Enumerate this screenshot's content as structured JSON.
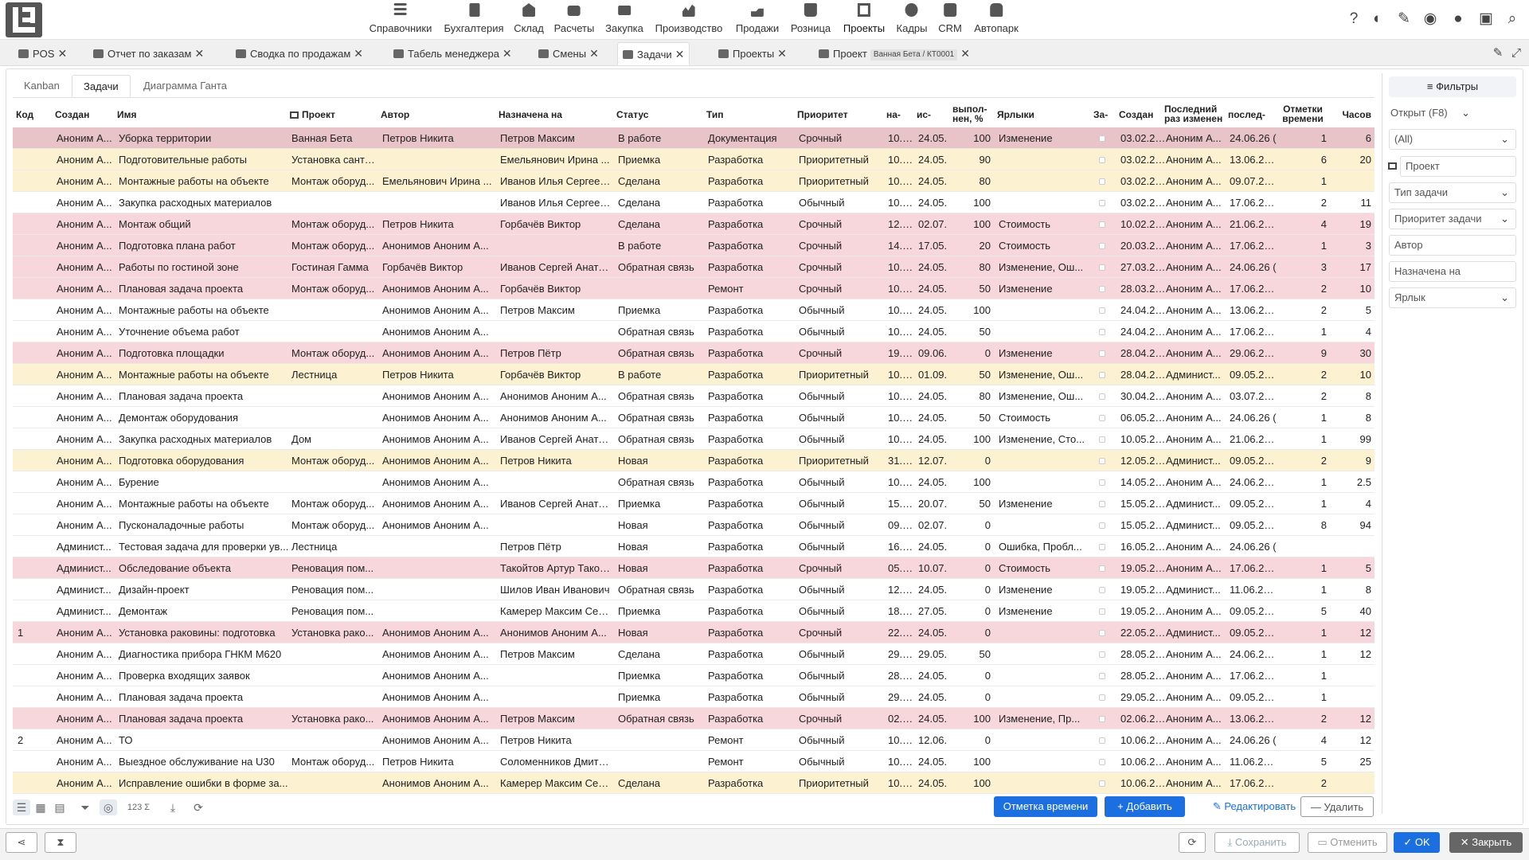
{
  "top_menu": [
    {
      "label": "Справочники",
      "icon": "list-icon"
    },
    {
      "label": "Бухгалтерия",
      "icon": "document-icon"
    },
    {
      "label": "Склад",
      "icon": "warehouse-icon"
    },
    {
      "label": "Расчеты",
      "icon": "money-icon"
    },
    {
      "label": "Закупка",
      "icon": "cart-icon"
    },
    {
      "label": "Производство",
      "icon": "factory-chart-icon"
    },
    {
      "label": "Продажи",
      "icon": "hand-coin-icon"
    },
    {
      "label": "Розница",
      "icon": "shopping-bag-icon"
    },
    {
      "label": "Проекты",
      "icon": "project-flow-icon"
    },
    {
      "label": "Кадры",
      "icon": "fingerprint-icon"
    },
    {
      "label": "CRM",
      "icon": "person-card-icon"
    },
    {
      "label": "Автопарк",
      "icon": "bus-icon"
    }
  ],
  "top_right_icons": [
    "help-icon",
    "theme-contrast-icon",
    "pin-icon",
    "eye-icon",
    "chat-icon",
    "lock-icon",
    "search-icon"
  ],
  "tabs": [
    {
      "label": "POS",
      "icon": "pos-icon"
    },
    {
      "label": "Отчет по заказам",
      "icon": "sort-report-icon"
    },
    {
      "label": "Сводка по продажам",
      "icon": "sales-summary-icon"
    },
    {
      "label": "Табель менеджера",
      "icon": "timesheet-icon"
    },
    {
      "label": "Смены",
      "icon": "shifts-icon"
    },
    {
      "label": "Задачи",
      "icon": "tasks-icon"
    },
    {
      "label": "Проекты",
      "icon": "projects-icon"
    },
    {
      "label": "Проект",
      "icon": "project-icon",
      "badge": "Ванная Бета / КТ0001"
    }
  ],
  "subtabs": [
    "Kanban",
    "Задачи",
    "Диаграмма Ганта"
  ],
  "columns": {
    "code": "Код",
    "created_by": "Создан",
    "name": "Имя",
    "project": "Проект",
    "author": "Автор",
    "assignee": "Назначена на",
    "status": "Статус",
    "type": "Тип",
    "priority": "Приоритет",
    "start": "на-",
    "end": "ис-",
    "done": "выпол-нен, %",
    "tags": "Ярлыки",
    "flag": "За-",
    "created": "Создан",
    "last_change": "Последний раз изменен",
    "last_date": "послед-",
    "time_marks": "Отметки времени",
    "hours": "Часов"
  },
  "rows": [
    {
      "hl": "first",
      "code": "",
      "cb": "Аноним А...",
      "name": "Уборка территории",
      "project": "Ванная Бета",
      "author": "Петров Никита",
      "assignee": "Петров Максим",
      "status": "В работе",
      "type": "Документация",
      "priority": "Срочный",
      "start": "10.05.",
      "end": "24.05.",
      "done": "100",
      "tags": "Изменение",
      "created": "03.02.25 2",
      "lc": "Аноним А...",
      "ld": "24.06.26 (",
      "tm": "1",
      "hours": "6"
    },
    {
      "hl": "yellow",
      "code": "",
      "cb": "Аноним А...",
      "name": "Подготовительные работы",
      "project": "Установка санте...",
      "author": "",
      "assignee": "Емельянович Ирина ...",
      "status": "Приемка",
      "type": "Разработка",
      "priority": "Приоритетный",
      "start": "10.05.",
      "end": "24.05.",
      "done": "90",
      "tags": "",
      "created": "03.02.25 2",
      "lc": "Аноним А...",
      "ld": "13.06.26 1",
      "tm": "6",
      "hours": "20"
    },
    {
      "hl": "yellow",
      "code": "",
      "cb": "Аноним А...",
      "name": "Монтажные работы на объекте",
      "project": "Монтаж оборуд...",
      "author": "Емельянович Ирина ...",
      "assignee": "Иванов Илья Сергеев...",
      "status": "Сделана",
      "type": "Разработка",
      "priority": "Приоритетный",
      "start": "10.05.",
      "end": "24.05.",
      "done": "80",
      "tags": "",
      "created": "03.02.25 2",
      "lc": "Аноним А...",
      "ld": "09.07.26 1",
      "tm": "1",
      "hours": ""
    },
    {
      "hl": "",
      "code": "",
      "cb": "Аноним А...",
      "name": "Закупка расходных материалов",
      "project": "",
      "author": "",
      "assignee": "Иванов Илья Сергеев...",
      "status": "Сделана",
      "type": "Разработка",
      "priority": "Обычный",
      "start": "10.05.",
      "end": "24.05.",
      "done": "100",
      "tags": "",
      "created": "03.02.25 2",
      "lc": "Аноним А...",
      "ld": "17.06.26 1",
      "tm": "2",
      "hours": "11"
    },
    {
      "hl": "red",
      "code": "",
      "cb": "Аноним А...",
      "name": "Монтаж общий",
      "project": "Монтаж оборуд...",
      "author": "Петров Никита",
      "assignee": "Горбачёв Виктор",
      "status": "Сделана",
      "type": "Разработка",
      "priority": "Срочный",
      "start": "12.05.",
      "end": "02.07.",
      "done": "100",
      "tags": "Стоимость",
      "created": "10.02.25 2",
      "lc": "Аноним А...",
      "ld": "21.06.26 1",
      "tm": "4",
      "hours": "19"
    },
    {
      "hl": "red",
      "code": "",
      "cb": "Аноним А...",
      "name": "Подготовка плана работ",
      "project": "Монтаж оборуд...",
      "author": "Анонимов Аноним А...",
      "assignee": "",
      "status": "В работе",
      "type": "Разработка",
      "priority": "Срочный",
      "start": "14.05.",
      "end": "17.05.",
      "done": "20",
      "tags": "Стоимость",
      "created": "20.03.25 0",
      "lc": "Аноним А...",
      "ld": "17.06.26 1",
      "tm": "1",
      "hours": "3"
    },
    {
      "hl": "red",
      "code": "",
      "cb": "Аноним А...",
      "name": "Работы по гостиной зоне",
      "project": "Гостиная Гамма",
      "author": "Горбачёв Виктор",
      "assignee": "Иванов Сергей Анато...",
      "status": "Обратная связь",
      "type": "Разработка",
      "priority": "Срочный",
      "start": "10.05.",
      "end": "24.05.",
      "done": "80",
      "tags": "Изменение, Ош...",
      "created": "27.03.25 0",
      "lc": "Аноним А...",
      "ld": "24.06.26 (",
      "tm": "3",
      "hours": "17"
    },
    {
      "hl": "red",
      "code": "",
      "cb": "Аноним А...",
      "name": "Плановая задача проекта",
      "project": "Монтаж оборуд...",
      "author": "Анонимов Аноним А...",
      "assignee": "Горбачёв Виктор",
      "status": "",
      "type": "Ремонт",
      "priority": "Срочный",
      "start": "10.05.",
      "end": "24.05.",
      "done": "50",
      "tags": "Изменение",
      "created": "28.03.25 0",
      "lc": "Аноним А...",
      "ld": "17.06.26 1",
      "tm": "2",
      "hours": "10"
    },
    {
      "hl": "",
      "code": "",
      "cb": "Аноним А...",
      "name": "Монтажные работы на объекте",
      "project": "",
      "author": "Анонимов Аноним А...",
      "assignee": "Петров Максим",
      "status": "Приемка",
      "type": "Разработка",
      "priority": "Обычный",
      "start": "10.05.",
      "end": "24.05.",
      "done": "100",
      "tags": "",
      "created": "24.04.25 1",
      "lc": "Аноним А...",
      "ld": "13.06.26 1",
      "tm": "2",
      "hours": "5"
    },
    {
      "hl": "",
      "code": "",
      "cb": "Аноним А...",
      "name": "Уточнение объема работ",
      "project": "",
      "author": "Анонимов Аноним А...",
      "assignee": "",
      "status": "Обратная связь",
      "type": "Разработка",
      "priority": "Обычный",
      "start": "10.05.",
      "end": "24.05.",
      "done": "50",
      "tags": "",
      "created": "24.04.25 1",
      "lc": "Аноним А...",
      "ld": "17.06.26 1",
      "tm": "1",
      "hours": "4"
    },
    {
      "hl": "red",
      "code": "",
      "cb": "Аноним А...",
      "name": "Подготовка площадки",
      "project": "Монтаж оборуд...",
      "author": "Анонимов Аноним А...",
      "assignee": "Петров Пётр",
      "status": "Обратная связь",
      "type": "Разработка",
      "priority": "Срочный",
      "start": "19.05.",
      "end": "09.06.",
      "done": "0",
      "tags": "Изменение",
      "created": "28.04.25 0",
      "lc": "Аноним А...",
      "ld": "29.06.26 2",
      "tm": "9",
      "hours": "30"
    },
    {
      "hl": "yellow",
      "code": "",
      "cb": "Аноним А...",
      "name": "Монтажные работы на объекте",
      "project": "Лестница",
      "author": "Петров Никита",
      "assignee": "Горбачёв Виктор",
      "status": "В работе",
      "type": "Разработка",
      "priority": "Приоритетный",
      "start": "10.05.",
      "end": "01.09.",
      "done": "50",
      "tags": "Изменение, Ош...",
      "created": "28.04.25 1",
      "lc": "Админист...",
      "ld": "09.05.26 1",
      "tm": "2",
      "hours": "10"
    },
    {
      "hl": "",
      "code": "",
      "cb": "Аноним А...",
      "name": "Плановая задача проекта",
      "project": "",
      "author": "Анонимов Аноним А...",
      "assignee": "Анонимов Аноним А...",
      "status": "Обратная связь",
      "type": "Разработка",
      "priority": "Обычный",
      "start": "10.05.",
      "end": "24.05.",
      "done": "80",
      "tags": "Изменение, Ош...",
      "created": "30.04.25 2",
      "lc": "Аноним А...",
      "ld": "03.07.26 1",
      "tm": "2",
      "hours": "8"
    },
    {
      "hl": "",
      "code": "",
      "cb": "Аноним А...",
      "name": "Демонтаж оборудования",
      "project": "",
      "author": "Анонимов Аноним А...",
      "assignee": "Анонимов Аноним А...",
      "status": "Обратная связь",
      "type": "Разработка",
      "priority": "Обычный",
      "start": "10.05.",
      "end": "24.05.",
      "done": "50",
      "tags": "Стоимость",
      "created": "06.05.25 2",
      "lc": "Аноним А...",
      "ld": "24.06.26 (",
      "tm": "1",
      "hours": "8"
    },
    {
      "hl": "",
      "code": "",
      "cb": "Аноним А...",
      "name": "Закупка расходных материалов",
      "project": "Дом",
      "author": "Анонимов Аноним А...",
      "assignee": "Иванов Сергей Анато...",
      "status": "Обратная связь",
      "type": "Разработка",
      "priority": "Обычный",
      "start": "10.05.",
      "end": "24.05.",
      "done": "100",
      "tags": "Изменение, Сто...",
      "created": "10.05.25 2",
      "lc": "Аноним А...",
      "ld": "21.06.26 1",
      "tm": "1",
      "hours": "99"
    },
    {
      "hl": "yellow",
      "code": "",
      "cb": "Аноним А...",
      "name": "Подготовка оборудования",
      "project": "Монтаж оборуд...",
      "author": "Анонимов Аноним А...",
      "assignee": "Петров Никита",
      "status": "Новая",
      "type": "Разработка",
      "priority": "Приоритетный",
      "start": "31.05.",
      "end": "12.07.",
      "done": "0",
      "tags": "",
      "created": "12.05.25 0",
      "lc": "Админист...",
      "ld": "09.05.26 1",
      "tm": "2",
      "hours": "9"
    },
    {
      "hl": "",
      "code": "",
      "cb": "Аноним А...",
      "name": "Бурение",
      "project": "",
      "author": "Анонимов Аноним А...",
      "assignee": "",
      "status": "Обратная связь",
      "type": "Разработка",
      "priority": "Обычный",
      "start": "10.05.",
      "end": "24.05.",
      "done": "100",
      "tags": "",
      "created": "14.05.25 0",
      "lc": "Аноним А...",
      "ld": "24.06.26 2",
      "tm": "1",
      "hours": "2.5"
    },
    {
      "hl": "",
      "code": "",
      "cb": "Аноним А...",
      "name": "Монтажные работы на объекте",
      "project": "Монтаж оборуд...",
      "author": "Анонимов Аноним А...",
      "assignee": "Иванов Сергей Анато...",
      "status": "Приемка",
      "type": "Разработка",
      "priority": "Обычный",
      "start": "15.06.",
      "end": "20.07.",
      "done": "50",
      "tags": "Изменение",
      "created": "15.05.25 1",
      "lc": "Админист...",
      "ld": "09.05.26 1",
      "tm": "1",
      "hours": "4"
    },
    {
      "hl": "",
      "code": "",
      "cb": "Аноним А...",
      "name": "Пусконаладочные работы",
      "project": "Монтаж оборуд...",
      "author": "Анонимов Аноним А...",
      "assignee": "",
      "status": "Новая",
      "type": "Разработка",
      "priority": "Обычный",
      "start": "09.06.",
      "end": "02.07.",
      "done": "0",
      "tags": "",
      "created": "15.05.25 1",
      "lc": "Админист...",
      "ld": "09.05.26 1",
      "tm": "8",
      "hours": "94"
    },
    {
      "hl": "",
      "code": "",
      "cb": "Админист...",
      "name": "Тестовая задача для проверки ув...",
      "project": "Лестница",
      "author": "",
      "assignee": "Петров Пётр",
      "status": "Новая",
      "type": "Разработка",
      "priority": "Обычный",
      "start": "16.05.",
      "end": "24.05.",
      "done": "0",
      "tags": "Ошибка, Пробл...",
      "created": "16.05.25 1",
      "lc": "Аноним А...",
      "ld": "24.06.26 (",
      "tm": "",
      "hours": ""
    },
    {
      "hl": "red",
      "code": "",
      "cb": "Админист...",
      "name": "Обследование объекта",
      "project": "Реновация пом...",
      "author": "",
      "assignee": "Такойтов Артур Такой...",
      "status": "Новая",
      "type": "Разработка",
      "priority": "Срочный",
      "start": "05.07.",
      "end": "10.07.",
      "done": "0",
      "tags": "Стоимость",
      "created": "19.05.25 0",
      "lc": "Аноним А...",
      "ld": "17.06.26 1",
      "tm": "1",
      "hours": "5"
    },
    {
      "hl": "",
      "code": "",
      "cb": "Админист...",
      "name": "Дизайн-проект",
      "project": "Реновация пом...",
      "author": "",
      "assignee": "Шилов Иван Иванович",
      "status": "Обратная связь",
      "type": "Разработка",
      "priority": "Обычный",
      "start": "12.05.",
      "end": "24.05.",
      "done": "0",
      "tags": "Изменение",
      "created": "19.05.25 0",
      "lc": "Админист...",
      "ld": "11.06.26 1",
      "tm": "1",
      "hours": "8"
    },
    {
      "hl": "",
      "code": "",
      "cb": "Админист...",
      "name": "Демонтаж",
      "project": "Реновация пом...",
      "author": "",
      "assignee": "Камерер Максим Сер...",
      "status": "Приемка",
      "type": "Разработка",
      "priority": "Обычный",
      "start": "18.05.",
      "end": "27.05.",
      "done": "0",
      "tags": "Изменение",
      "created": "19.05.25 0",
      "lc": "Аноним А...",
      "ld": "09.05.26 1",
      "tm": "5",
      "hours": "40"
    },
    {
      "hl": "red",
      "code": "1",
      "cb": "Аноним А...",
      "name": "Установка раковины: подготовка",
      "project": "Установка рако...",
      "author": "Анонимов Аноним А...",
      "assignee": "Анонимов Аноним А...",
      "status": "Новая",
      "type": "Разработка",
      "priority": "Срочный",
      "start": "22.05.",
      "end": "24.05.",
      "done": "0",
      "tags": "",
      "created": "22.05.25 0",
      "lc": "Админист...",
      "ld": "09.05.26 1",
      "tm": "1",
      "hours": "12"
    },
    {
      "hl": "",
      "code": "",
      "cb": "Аноним А...",
      "name": "Диагностика прибора ГНКМ М620",
      "project": "",
      "author": "Анонимов Аноним А...",
      "assignee": "Петров Максим",
      "status": "Сделана",
      "type": "Разработка",
      "priority": "Обычный",
      "start": "29.05.",
      "end": "29.05.",
      "done": "50",
      "tags": "",
      "created": "28.05.25 0",
      "lc": "Аноним А...",
      "ld": "24.06.26 2",
      "tm": "1",
      "hours": "12"
    },
    {
      "hl": "",
      "code": "",
      "cb": "Аноним А...",
      "name": "Проверка входящих заявок",
      "project": "",
      "author": "Анонимов Аноним А...",
      "assignee": "",
      "status": "Приемка",
      "type": "Разработка",
      "priority": "Обычный",
      "start": "28.05.",
      "end": "24.05.",
      "done": "0",
      "tags": "",
      "created": "28.05.25 0",
      "lc": "Аноним А...",
      "ld": "17.06.26 1",
      "tm": "1",
      "hours": ""
    },
    {
      "hl": "",
      "code": "",
      "cb": "Аноним А...",
      "name": "Плановая задача проекта",
      "project": "",
      "author": "Анонимов Аноним А...",
      "assignee": "",
      "status": "Приемка",
      "type": "Разработка",
      "priority": "Обычный",
      "start": "29.05.",
      "end": "24.05.",
      "done": "0",
      "tags": "",
      "created": "29.05.25 0",
      "lc": "Аноним А...",
      "ld": "09.05.26 1",
      "tm": "1",
      "hours": ""
    },
    {
      "hl": "red",
      "code": "",
      "cb": "Аноним А...",
      "name": "Плановая задача проекта",
      "project": "Установка рако...",
      "author": "Анонимов Аноним А...",
      "assignee": "Петров Максим",
      "status": "Обратная связь",
      "type": "Разработка",
      "priority": "Срочный",
      "start": "02.06.",
      "end": "24.05.",
      "done": "100",
      "tags": "Изменение, Пр...",
      "created": "02.06.25 2",
      "lc": "Аноним А...",
      "ld": "13.06.26 1",
      "tm": "2",
      "hours": "12"
    },
    {
      "hl": "",
      "code": "2",
      "cb": "Аноним А...",
      "name": "ТО",
      "project": "",
      "author": "Анонимов Аноним А...",
      "assignee": "Петров Никита",
      "status": "",
      "type": "Ремонт",
      "priority": "Обычный",
      "start": "10.06.",
      "end": "12.06.",
      "done": "0",
      "tags": "",
      "created": "10.06.25 1",
      "lc": "Аноним А...",
      "ld": "24.06.26 (",
      "tm": "4",
      "hours": "12"
    },
    {
      "hl": "",
      "code": "",
      "cb": "Аноним А...",
      "name": "Выездное обслуживание на U30",
      "project": "Монтаж оборуд...",
      "author": "Петров Никита",
      "assignee": "Соломенников Дмитр...",
      "status": "",
      "type": "Ремонт",
      "priority": "Обычный",
      "start": "10.06.",
      "end": "24.05.",
      "done": "100",
      "tags": "",
      "created": "10.06.25 1",
      "lc": "Аноним А...",
      "ld": "11.06.26 1",
      "tm": "5",
      "hours": "25"
    },
    {
      "hl": "yellow",
      "code": "",
      "cb": "Аноним А...",
      "name": "Исправление ошибки в форме за...",
      "project": "",
      "author": "Анонимов Аноним А...",
      "assignee": "Камерер Максим Сер...",
      "status": "Сделана",
      "type": "Разработка",
      "priority": "Приоритетный",
      "start": "10.06.",
      "end": "24.05.",
      "done": "100",
      "tags": "",
      "created": "10.06.25 1",
      "lc": "Аноним А...",
      "ld": "17.06.26 1",
      "tm": "2",
      "hours": ""
    }
  ],
  "bottom_toolbar_icons": [
    "list-view-icon",
    "grid-view-icon",
    "calendar-view-icon",
    "filter-icon",
    "settings-circle-icon",
    "count-sum-icon",
    "download-icon",
    "refresh-icon"
  ],
  "count_sum_label": "123 Σ",
  "actions": {
    "time_mark": "Отметка времени",
    "add": "Добавить",
    "edit": "Редактировать",
    "delete": "Удалить"
  },
  "filters": {
    "title": "Фильтры",
    "open": "Открыт (F8)",
    "all": "(All)",
    "project": "Проект",
    "task_type": "Тип задачи",
    "priority": "Приоритет задачи",
    "author": "Автор",
    "assignee": "Назначена на",
    "tag": "Ярлык"
  },
  "footer": {
    "save": "Сохранить",
    "cancel": "Отменить",
    "ok": "OK",
    "close": "Закрыть"
  },
  "colors": {
    "primary": "#1c6fe0",
    "row_red": "#f8d7dc",
    "row_yellow": "#fcf1d0",
    "row_selected": "#e8c3c8"
  }
}
